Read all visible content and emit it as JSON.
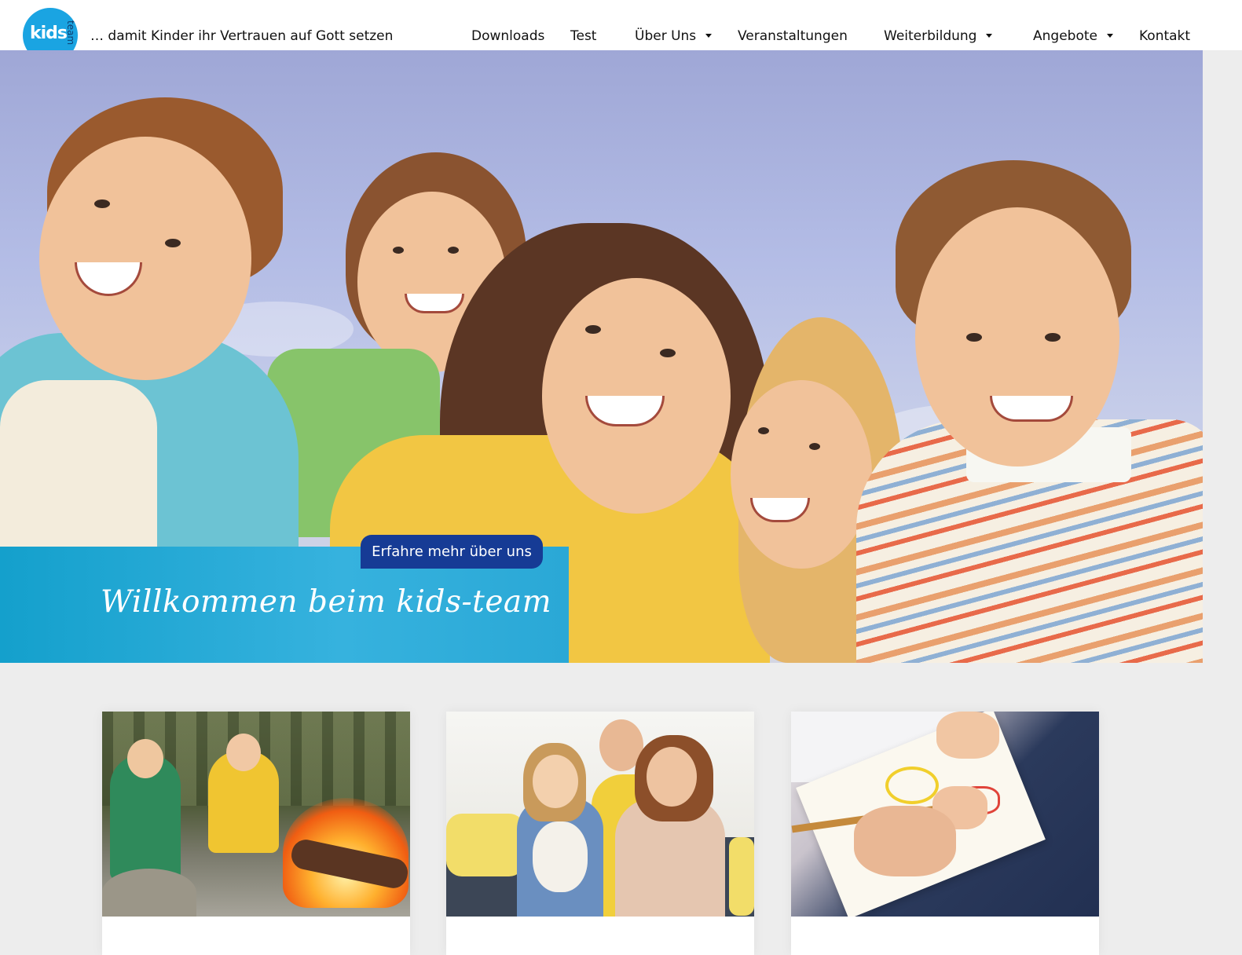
{
  "header": {
    "logo": {
      "primary": "kids",
      "secondary": "team"
    },
    "tagline": "… damit Kinder ihr Vertrauen auf Gott setzen",
    "nav": [
      {
        "label": "Downloads",
        "has_dropdown": false
      },
      {
        "label": "Test",
        "has_dropdown": false
      },
      {
        "label": "Über Uns",
        "has_dropdown": true
      },
      {
        "label": "Veranstaltungen",
        "has_dropdown": false
      },
      {
        "label": "Weiterbildung",
        "has_dropdown": true
      },
      {
        "label": "Angebote",
        "has_dropdown": true
      },
      {
        "label": "Kontakt",
        "has_dropdown": false
      }
    ]
  },
  "hero": {
    "title": "Willkommen beim kids-team",
    "cta_label": "Erfahre mehr über uns",
    "image": "group-of-smiling-children"
  },
  "cards": [
    {
      "image": "children-campfire-photo"
    },
    {
      "image": "family-on-sofa-photo"
    },
    {
      "image": "child-drawing-photo"
    }
  ],
  "colors": {
    "brand_blue": "#1aa4e2",
    "cta_navy": "#163b95",
    "panel_blue": "#2aa8d6",
    "page_bg": "#ededed"
  }
}
